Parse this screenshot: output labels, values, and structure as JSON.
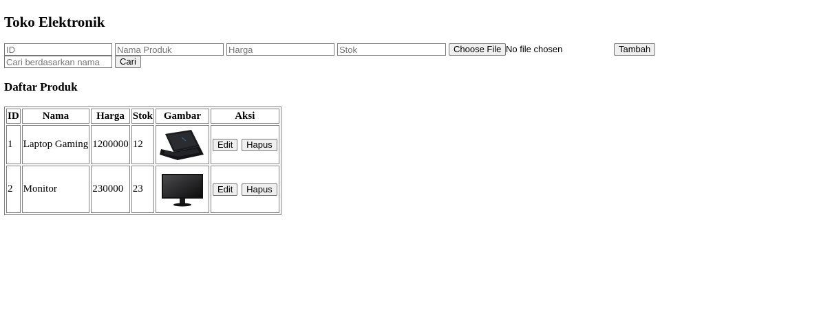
{
  "page": {
    "title": "Toko Elektronik"
  },
  "form": {
    "id_placeholder": "ID",
    "nama_placeholder": "Nama Produk",
    "harga_placeholder": "Harga",
    "stok_placeholder": "Stok",
    "choose_file_label": "Choose File",
    "file_status": "No file chosen",
    "add_label": "Tambah"
  },
  "search": {
    "placeholder": "Cari berdasarkan nama",
    "button_label": "Cari"
  },
  "list": {
    "title": "Daftar Produk",
    "columns": [
      "ID",
      "Nama",
      "Harga",
      "Stok",
      "Gambar",
      "Aksi"
    ],
    "rows": [
      {
        "id": "1",
        "nama": "Laptop Gaming",
        "harga": "1200000",
        "stok": "12",
        "image": "laptop-image",
        "edit": "Edit",
        "hapus": "Hapus"
      },
      {
        "id": "2",
        "nama": "Monitor",
        "harga": "230000",
        "stok": "23",
        "image": "monitor-image",
        "edit": "Edit",
        "hapus": "Hapus"
      }
    ]
  }
}
